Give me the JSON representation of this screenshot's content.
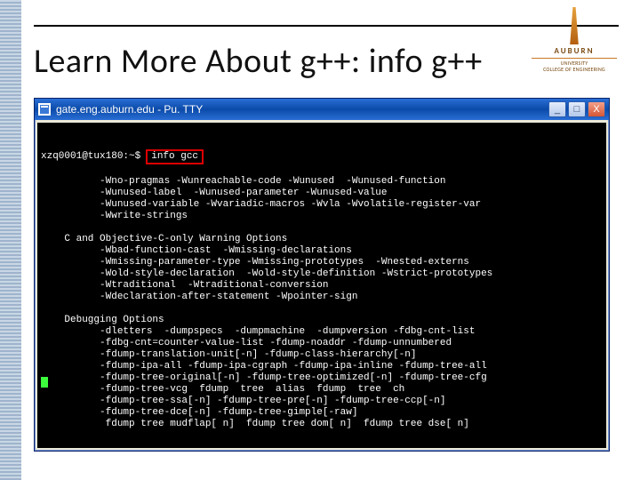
{
  "slide": {
    "title": "Learn More About g++: info g++"
  },
  "logo": {
    "name": "AUBURN",
    "sub1": "UNIVERSITY",
    "sub2": "COLLEGE OF ENGINEERING"
  },
  "putty": {
    "title": "gate.eng.auburn.edu - Pu. TTY",
    "prompt": "xzq0001@tux180:~$",
    "command": "info gcc",
    "lines": [
      "          -Wno-pragmas -Wunreachable-code -Wunused  -Wunused-function",
      "          -Wunused-label  -Wunused-parameter -Wunused-value",
      "          -Wunused-variable -Wvariadic-macros -Wvla -Wvolatile-register-var",
      "          -Wwrite-strings",
      "",
      "    C and Objective-C-only Warning Options",
      "          -Wbad-function-cast  -Wmissing-declarations",
      "          -Wmissing-parameter-type -Wmissing-prototypes  -Wnested-externs",
      "          -Wold-style-declaration  -Wold-style-definition -Wstrict-prototypes",
      "          -Wtraditional  -Wtraditional-conversion",
      "          -Wdeclaration-after-statement -Wpointer-sign",
      "",
      "    Debugging Options",
      "          -dletters  -dumpspecs  -dumpmachine  -dumpversion -fdbg-cnt-list",
      "          -fdbg-cnt=counter-value-list -fdump-noaddr -fdump-unnumbered",
      "          -fdump-translation-unit[-n] -fdump-class-hierarchy[-n]",
      "          -fdump-ipa-all -fdump-ipa-cgraph -fdump-ipa-inline -fdump-tree-all",
      "          -fdump-tree-original[-n] -fdump-tree-optimized[-n] -fdump-tree-cfg",
      "          -fdump-tree-vcg  fdump  tree  alias  fdump  tree  ch",
      "          -fdump-tree-ssa[-n] -fdump-tree-pre[-n] -fdump-tree-ccp[-n]",
      "          -fdump-tree-dce[-n] -fdump-tree-gimple[-raw]",
      "           fdump tree mudflap[ n]  fdump tree dom[ n]  fdump tree dse[ n]"
    ]
  },
  "buttons": {
    "min": "_",
    "max": "□",
    "close": "X"
  }
}
